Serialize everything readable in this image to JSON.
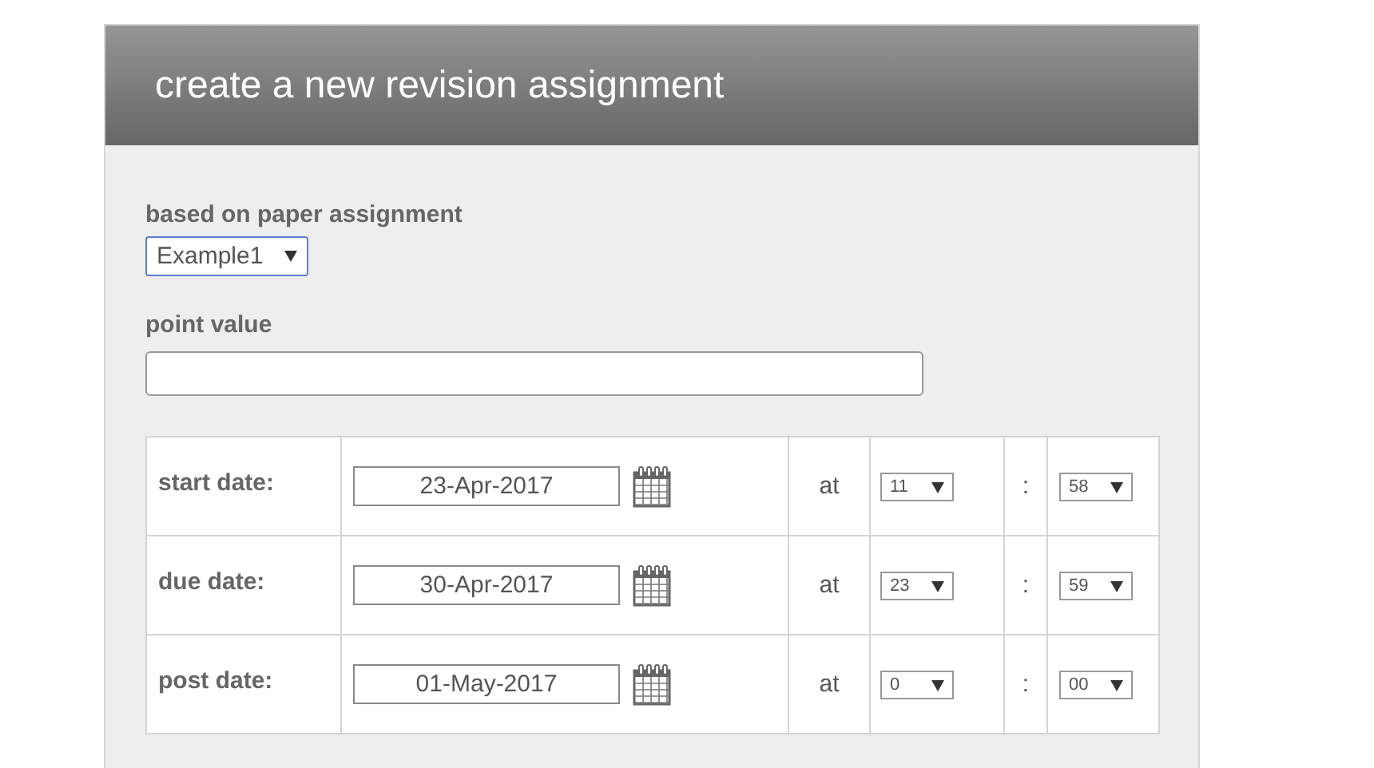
{
  "panel": {
    "title": "create a new revision assignment"
  },
  "paper_assignment": {
    "label": "based on paper assignment",
    "value": "Example1"
  },
  "point_value": {
    "label": "point value"
  },
  "dates": [
    {
      "label": "start date:",
      "date": "23-Apr-2017",
      "at": "at",
      "hour": "11",
      "separator": ":",
      "minute": "58"
    },
    {
      "label": "due date:",
      "date": "30-Apr-2017",
      "at": "at",
      "hour": "23",
      "separator": ":",
      "minute": "59"
    },
    {
      "label": "post date:",
      "date": "01-May-2017",
      "at": "at",
      "hour": "0",
      "separator": ":",
      "minute": "00"
    }
  ]
}
